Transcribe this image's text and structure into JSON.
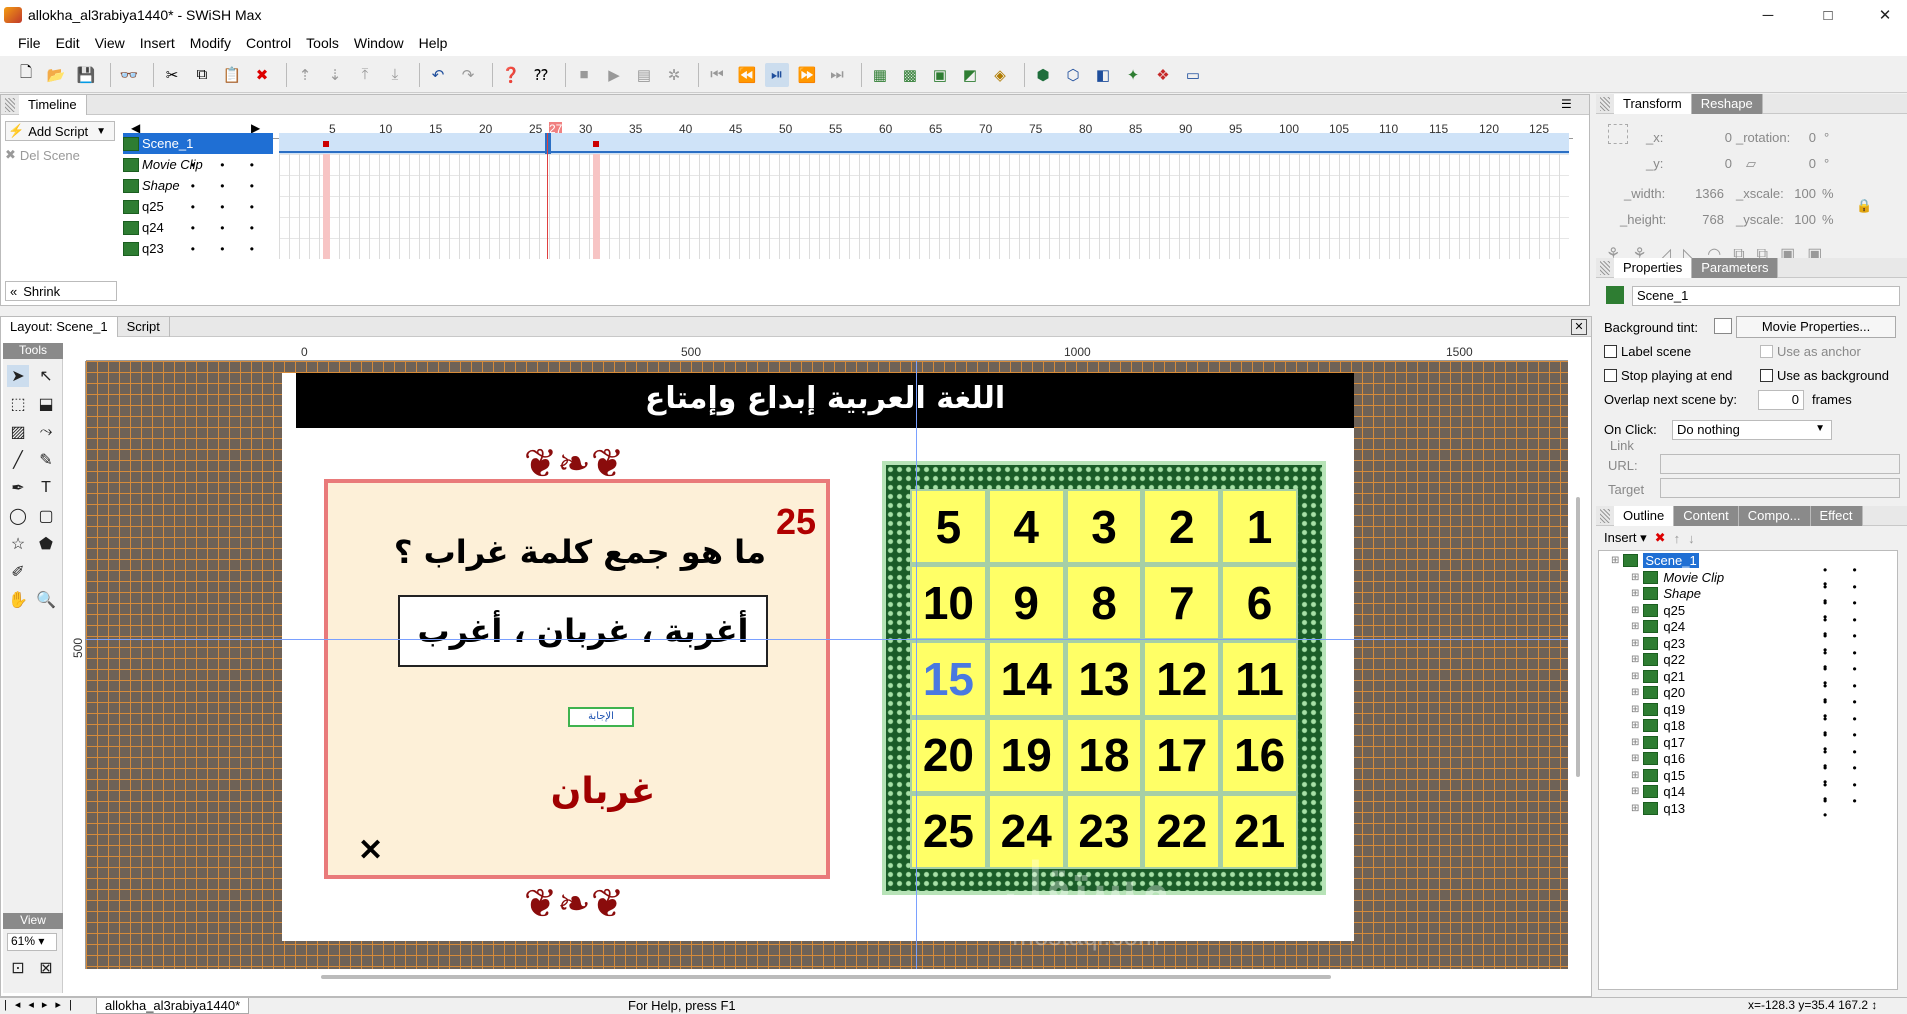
{
  "window": {
    "title": "allokha_al3rabiya1440* - SWiSH Max",
    "minimize": "─",
    "maximize": "□",
    "close": "✕"
  },
  "menu": [
    "File",
    "Edit",
    "View",
    "Insert",
    "Modify",
    "Control",
    "Tools",
    "Window",
    "Help"
  ],
  "timeline": {
    "tab": "Timeline",
    "add_script": "Add Script",
    "del_scene": "Del Scene",
    "shrink": "Shrink",
    "ruler": [
      "5",
      "10",
      "15",
      "20",
      "25",
      "27",
      "30",
      "35",
      "40",
      "45",
      "50",
      "55",
      "60",
      "65",
      "70",
      "75",
      "80",
      "85",
      "90",
      "95",
      "100",
      "105",
      "110",
      "115",
      "120",
      "125"
    ],
    "layers": [
      {
        "name": "Scene_1",
        "dots": ""
      },
      {
        "name": "Movie Clip",
        "dots": "• • •"
      },
      {
        "name": "Shape",
        "dots": "• • •"
      },
      {
        "name": "q25",
        "dots": "• • •"
      },
      {
        "name": "q24",
        "dots": "• • •"
      },
      {
        "name": "q23",
        "dots": "• • •"
      }
    ]
  },
  "layout": {
    "tab_layout": "Layout: Scene_1",
    "tab_script": "Script",
    "tools_label": "Tools",
    "view_label": "View",
    "zoom": "61%",
    "ruler_top": [
      "0",
      "500",
      "1000",
      "1500"
    ],
    "ruler_left": "500"
  },
  "stage": {
    "banner": "اللغة العربية إبداع وإمتاع",
    "question_number": "25",
    "question": "ما هو جمع كلمة غراب ؟",
    "options": "أغربة ، غربان ، أغرب",
    "answer_button": "الإجابة",
    "answer": "غربان",
    "close": "✕",
    "ornament": "❦❧❦",
    "grid": [
      "5",
      "4",
      "3",
      "2",
      "1",
      "10",
      "9",
      "8",
      "7",
      "6",
      "15",
      "14",
      "13",
      "12",
      "11",
      "20",
      "19",
      "18",
      "17",
      "16",
      "25",
      "24",
      "23",
      "22",
      "21"
    ],
    "highlight": "15"
  },
  "transform": {
    "tab1": "Transform",
    "tab2": "Reshape",
    "x_label": "_x:",
    "x": "0",
    "rot_label": "_rotation:",
    "rot": "0",
    "deg1": "°",
    "y_label": "_y:",
    "y": "0",
    "skew": "0",
    "deg2": "°",
    "w_label": "_width:",
    "w": "1366",
    "xs_label": "_xscale:",
    "xs": "100",
    "pct1": "%",
    "h_label": "_height:",
    "h": "768",
    "ys_label": "_yscale:",
    "ys": "100",
    "pct2": "%"
  },
  "properties": {
    "tab1": "Properties",
    "tab2": "Parameters",
    "scene": "Scene_1",
    "bg_tint": "Background tint:",
    "movie_props": "Movie Properties...",
    "label_scene": "Label scene",
    "use_anchor": "Use as anchor",
    "stop_playing": "Stop playing at end",
    "use_bg": "Use as background",
    "overlap": "Overlap next scene by:",
    "overlap_val": "0",
    "frames": "frames",
    "onclick": "On Click:",
    "onclick_val": "Do nothing",
    "link": "Link",
    "url": "URL:",
    "target": "Target"
  },
  "outline": {
    "tabs": [
      "Outline",
      "Content",
      "Compo...",
      "Effect"
    ],
    "insert": "Insert",
    "items": [
      {
        "name": "Scene_1",
        "level": 0
      },
      {
        "name": "Movie Clip",
        "level": 1
      },
      {
        "name": "Shape",
        "level": 1
      },
      {
        "name": "q25",
        "level": 1
      },
      {
        "name": "q24",
        "level": 1
      },
      {
        "name": "q23",
        "level": 1
      },
      {
        "name": "q22",
        "level": 1
      },
      {
        "name": "q21",
        "level": 1
      },
      {
        "name": "q20",
        "level": 1
      },
      {
        "name": "q19",
        "level": 1
      },
      {
        "name": "q18",
        "level": 1
      },
      {
        "name": "q17",
        "level": 1
      },
      {
        "name": "q16",
        "level": 1
      },
      {
        "name": "q15",
        "level": 1
      },
      {
        "name": "q14",
        "level": 1
      },
      {
        "name": "q13",
        "level": 1
      }
    ]
  },
  "status": {
    "doc_tab": "allokha_al3rabiya1440*",
    "help": "For Help, press F1",
    "coords": "x=-128.3 y=35.4  167.2 ↕"
  },
  "watermark": {
    "ar": "مستقل",
    "en": "mostaql.com"
  }
}
